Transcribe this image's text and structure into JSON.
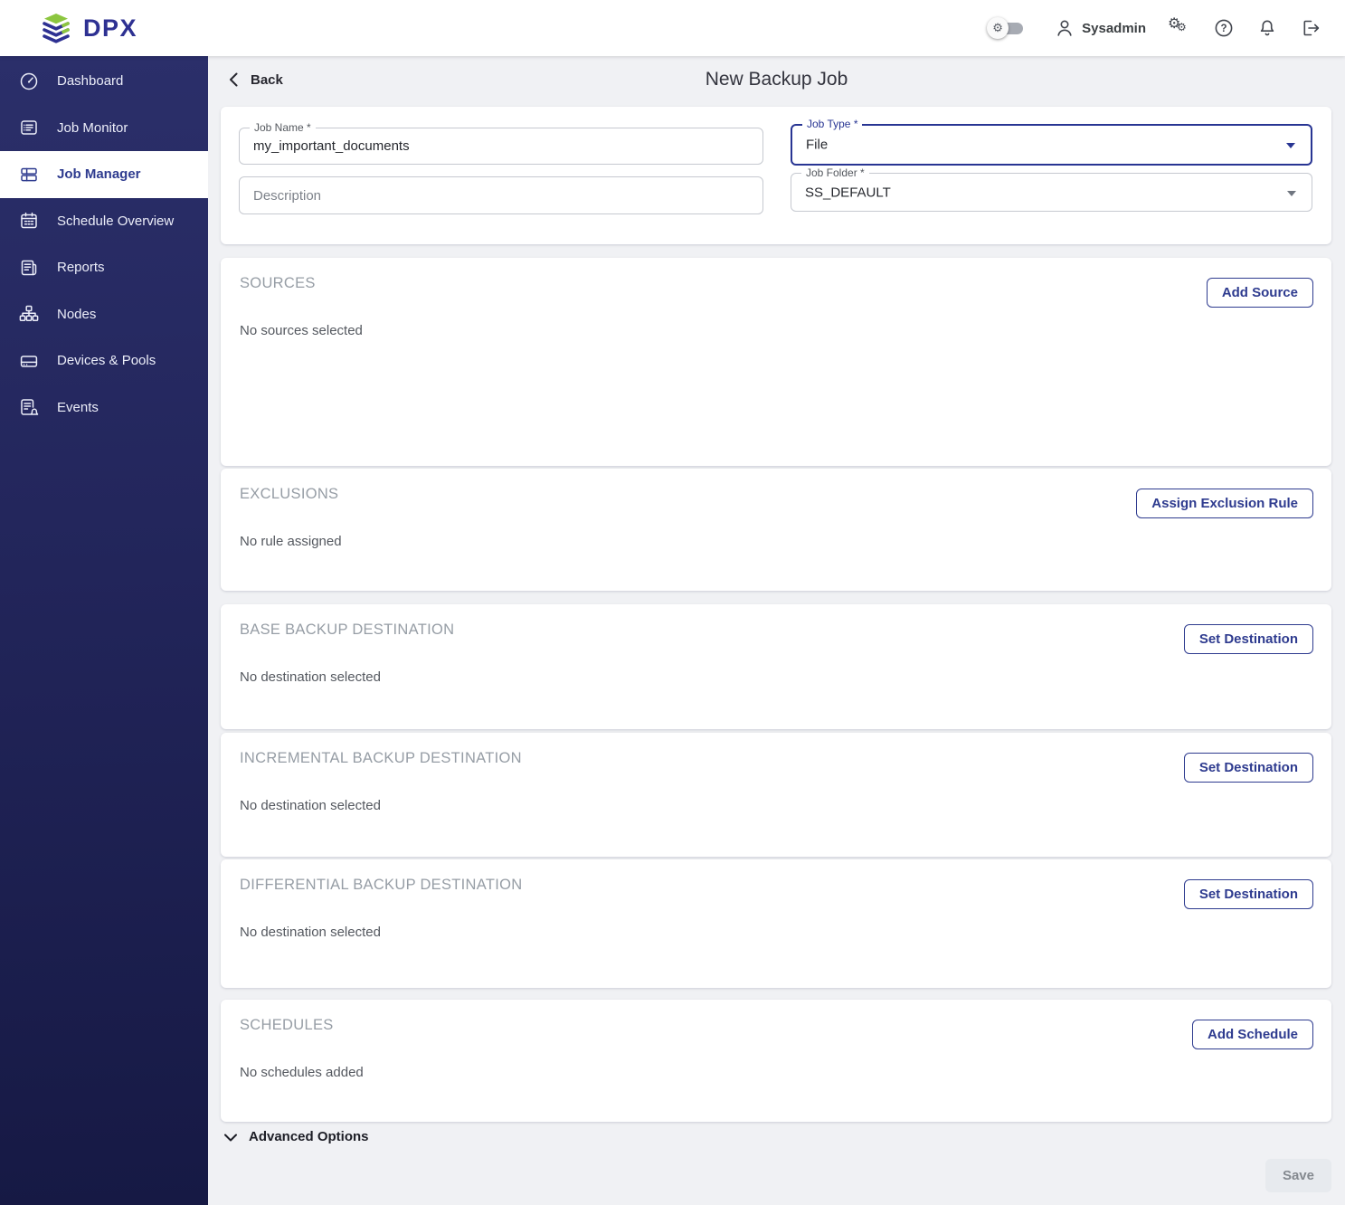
{
  "app": {
    "logo_text": "DPX",
    "logo_icon": "dpx-layers-icon"
  },
  "topbar": {
    "theme_toggle": {
      "icon": "gear-icon",
      "state": "off"
    },
    "user": {
      "icon": "person-icon",
      "name": "Sysadmin"
    },
    "settings_icon": "gears-icon",
    "help_icon": "help-icon",
    "notifications_icon": "bell-icon",
    "logout_icon": "logout-icon"
  },
  "sidebar": {
    "items": [
      {
        "label": "Dashboard",
        "icon": "dashboard-icon",
        "active": false
      },
      {
        "label": "Job Monitor",
        "icon": "job-monitor-icon",
        "active": false
      },
      {
        "label": "Job Manager",
        "icon": "job-manager-icon",
        "active": true
      },
      {
        "label": "Schedule Overview",
        "icon": "calendar-icon",
        "active": false
      },
      {
        "label": "Reports",
        "icon": "reports-icon",
        "active": false
      },
      {
        "label": "Nodes",
        "icon": "nodes-icon",
        "active": false
      },
      {
        "label": "Devices & Pools",
        "icon": "hard-drive-icon",
        "active": false
      },
      {
        "label": "Events",
        "icon": "events-icon",
        "active": false
      }
    ]
  },
  "page": {
    "back": "Back",
    "title": "New Backup Job"
  },
  "form": {
    "job_name": {
      "label": "Job Name *",
      "value": "my_important_documents"
    },
    "description": {
      "placeholder": "Description",
      "value": ""
    },
    "job_type": {
      "label": "Job Type *",
      "value": "File",
      "focused": true
    },
    "job_folder": {
      "label": "Job Folder *",
      "value": "SS_DEFAULT"
    }
  },
  "sections": [
    {
      "title": "SOURCES",
      "empty": "No sources selected",
      "action": "Add Source"
    },
    {
      "title": "EXCLUSIONS",
      "empty": "No rule assigned",
      "action": "Assign Exclusion Rule"
    },
    {
      "title": "BASE BACKUP DESTINATION",
      "empty": "No destination selected",
      "action": "Set Destination"
    },
    {
      "title": "INCREMENTAL BACKUP DESTINATION",
      "empty": "No destination selected",
      "action": "Set Destination"
    },
    {
      "title": "DIFFERENTIAL BACKUP DESTINATION",
      "empty": "No destination selected",
      "action": "Set Destination"
    },
    {
      "title": "SCHEDULES",
      "empty": "No schedules added",
      "action": "Add Schedule"
    }
  ],
  "footer": {
    "advanced": "Advanced Options",
    "save": "Save",
    "save_enabled": false
  },
  "colors": {
    "accent": "#2e3b8f",
    "focus": "#283593",
    "logo_blue": "#2e3192",
    "logo_green": "#8cc63f",
    "sidebar_top": "#2b2f6a",
    "sidebar_bottom": "#161944",
    "main_bg": "#f0f1f4",
    "disabled_bg": "#e7eaee"
  }
}
